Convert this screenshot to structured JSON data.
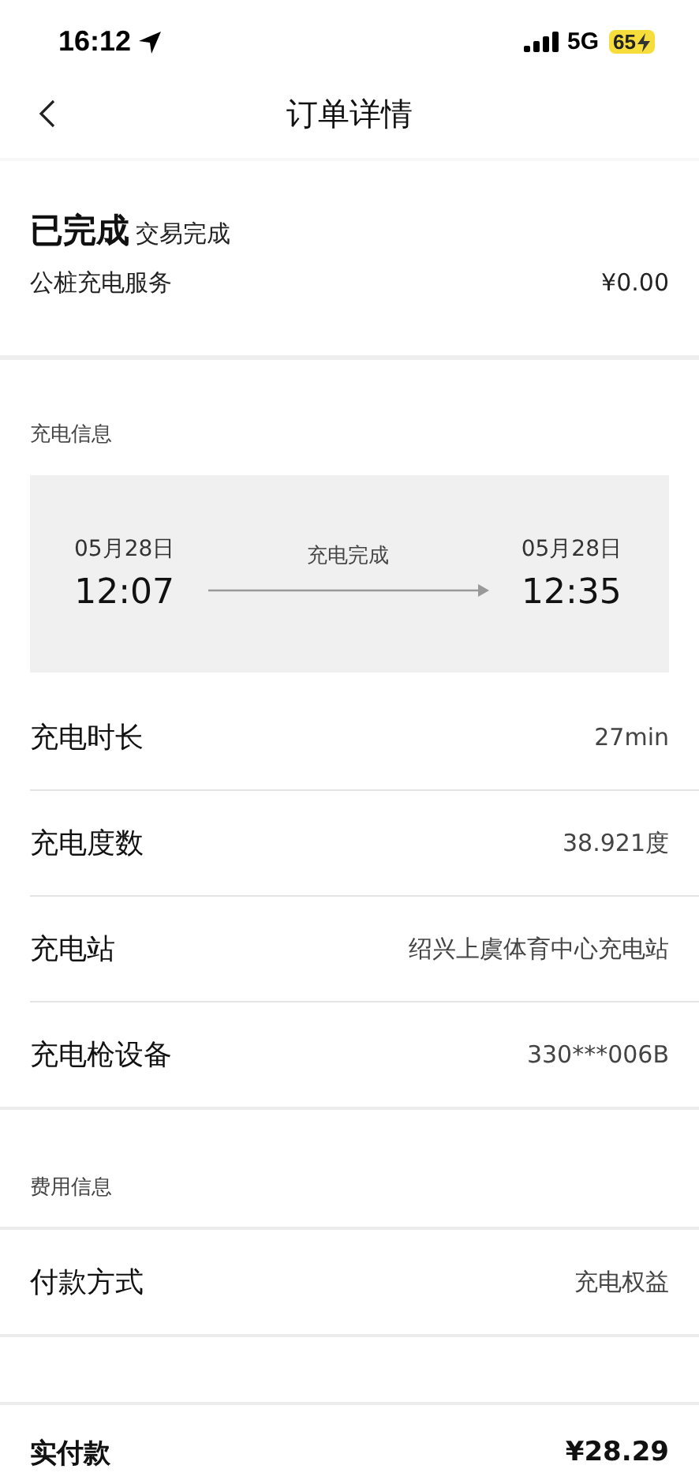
{
  "status_bar": {
    "time": "16:12",
    "network": "5G",
    "battery": "65",
    "charging": true
  },
  "nav": {
    "title": "订单详情"
  },
  "order": {
    "status": "已完成",
    "status_note": "交易完成",
    "service": "公桩充电服务",
    "service_amount": "¥0.00"
  },
  "charging_info": {
    "heading": "充电信息",
    "start": {
      "date": "05月28日",
      "time": "12:07"
    },
    "state": "充电完成",
    "end": {
      "date": "05月28日",
      "time": "12:35"
    },
    "rows": [
      {
        "label": "充电时长",
        "value": "27min"
      },
      {
        "label": "充电度数",
        "value": "38.921度"
      },
      {
        "label": "充电站",
        "value": "绍兴上虞体育中心充电站"
      },
      {
        "label": "充电枪设备",
        "value": "330***006B"
      }
    ]
  },
  "fee_info": {
    "heading": "费用信息",
    "rows": [
      {
        "label": "付款方式",
        "value": "充电权益"
      }
    ]
  },
  "total": {
    "label": "实付款",
    "value": "¥28.29"
  }
}
